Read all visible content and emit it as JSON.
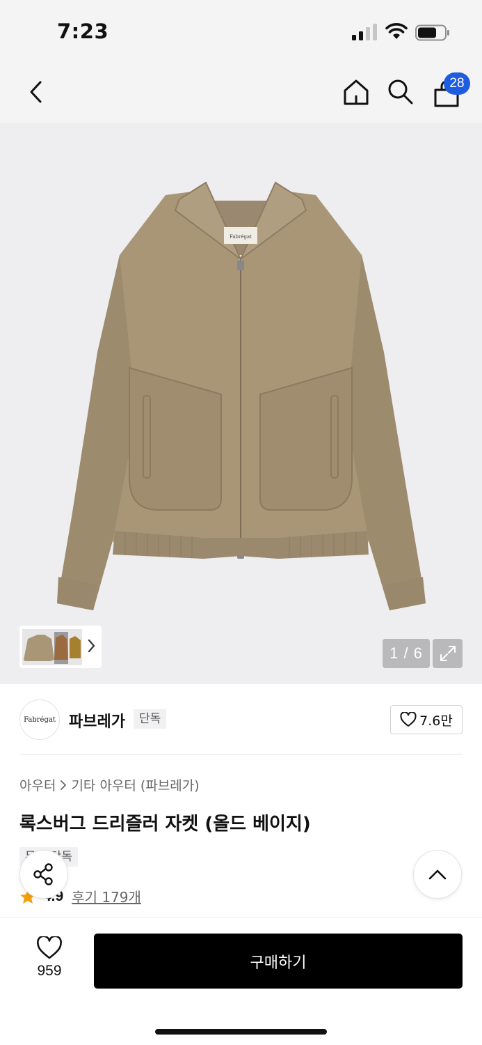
{
  "status_bar": {
    "time": "7:23",
    "battery_level": 0.7
  },
  "header": {
    "cart_count": "28"
  },
  "gallery": {
    "page_indicator": "1 / 6",
    "label_text": "Fabrégat",
    "colors": {
      "jacket": "#a89677",
      "background": "#eeeef0"
    }
  },
  "brand": {
    "logo_text": "Fabrégat",
    "name": "파브레가",
    "tag": "단독",
    "likes": "7.6만"
  },
  "product": {
    "breadcrumb": [
      "아우터",
      "기타 아우터 (파브레가)"
    ],
    "title": "록스버그 드리즐러 자켓 (올드 베이지)",
    "tag": "무료 단독",
    "rating": "4.9",
    "reviews": "후기 179개"
  },
  "purchase": {
    "wish_count": "959",
    "buy_label": "구매하기"
  }
}
